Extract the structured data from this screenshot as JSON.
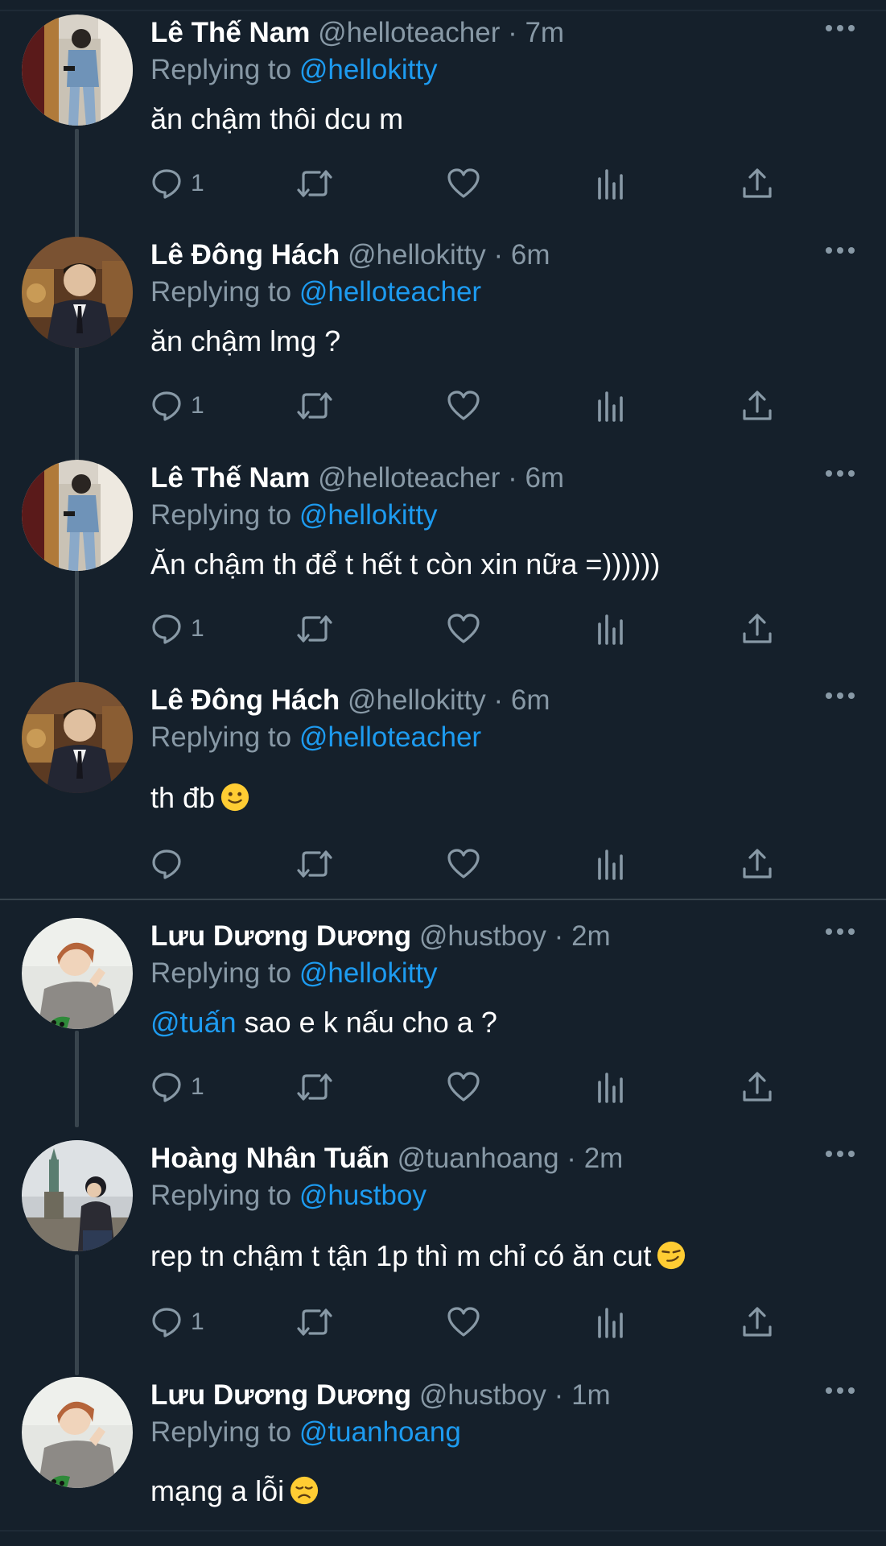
{
  "colors": {
    "background": "#15202b",
    "text_primary": "#ffffff",
    "text_secondary": "#8899a6",
    "accent": "#1d9bf0",
    "divider": "#38444d"
  },
  "reply_prefix": "Replying to",
  "tweets": [
    {
      "name": "Lê Thế Nam",
      "handle": "@helloteacher",
      "separator": "·",
      "time": "7m",
      "reply_to": "@hellokitty",
      "text": "ăn chậm thôi dcu m",
      "reply_count": "1",
      "avatar": "man-by-mirror-avatar"
    },
    {
      "name": "Lê Đông Hách",
      "handle": "@hellokitty",
      "separator": "·",
      "time": "6m",
      "reply_to": "@helloteacher",
      "text": "ăn chậm lmg ?",
      "reply_count": "1",
      "avatar": "man-in-suit-avatar"
    },
    {
      "name": "Lê Thế Nam",
      "handle": "@helloteacher",
      "separator": "·",
      "time": "6m",
      "reply_to": "@hellokitty",
      "text": "Ăn chậm th để t hết t còn xin nữa =))))))",
      "reply_count": "1",
      "avatar": "man-by-mirror-avatar"
    },
    {
      "name": "Lê Đông Hách",
      "handle": "@hellokitty",
      "separator": "·",
      "time": "6m",
      "reply_to": "@helloteacher",
      "text": "th đb",
      "emoji": "slightly-smiling-face-emoji",
      "reply_count": "",
      "avatar": "man-in-suit-avatar"
    },
    {
      "name": "Lưu Dương Dương",
      "handle": "@hustboy",
      "separator": "·",
      "time": "2m",
      "reply_to": "@hellokitty",
      "mention": "@tuấn",
      "text": " sao e k nấu cho a ?",
      "reply_count": "1",
      "avatar": "man-in-grey-sweater-avatar"
    },
    {
      "name": "Hoàng Nhân Tuấn",
      "handle": "@tuanhoang",
      "separator": "·",
      "time": "2m",
      "reply_to": "@hustboy",
      "text": "rep tn chậm t tận 1p thì m chỉ có ăn cut",
      "emoji": "smirking-face-emoji",
      "reply_count": "1",
      "avatar": "man-at-statue-of-liberty-avatar"
    },
    {
      "name": "Lưu Dương Dương",
      "handle": "@hustboy",
      "separator": "·",
      "time": "1m",
      "reply_to": "@tuanhoang",
      "text": "mạng a lỗi",
      "emoji": "disappointed-face-emoji",
      "reply_count": "",
      "avatar": "man-in-grey-sweater-avatar"
    }
  ]
}
